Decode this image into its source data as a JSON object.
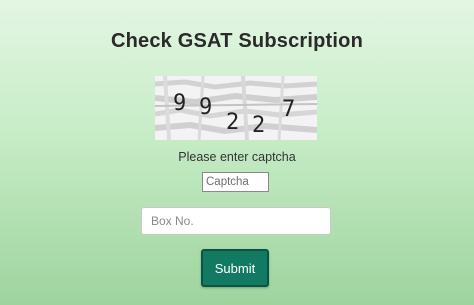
{
  "page": {
    "title": "Check GSAT Subscription"
  },
  "captcha": {
    "characters": [
      "9",
      "9",
      "2",
      "2",
      "7"
    ],
    "prompt": "Please enter captcha",
    "input_placeholder": "Captcha"
  },
  "box": {
    "placeholder": "Box No."
  },
  "submit": {
    "label": "Submit"
  },
  "colors": {
    "background_top": "#e3f6e3",
    "background_bottom": "#9ed39e",
    "button": "#127a63",
    "button_border": "#0a5443"
  }
}
